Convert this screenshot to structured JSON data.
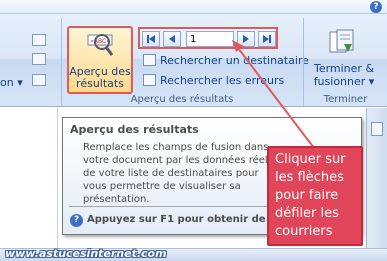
{
  "ribbon": {
    "partial_group_label": "on ▾",
    "apercu_button_line1": "Aperçu des",
    "apercu_button_line2": "résultats",
    "apercu_button_image_text": "«ABC»",
    "record_value": "1",
    "rechercher_destinataire": "Rechercher un destinataire",
    "rechercher_erreurs": "Rechercher les erreurs",
    "group_apercu_label": "Aperçu des résultats",
    "terminer_line1": "Terminer &",
    "terminer_line2": "fusionner ▾",
    "group_terminer_label": "Terminer",
    "help_glyph": "?"
  },
  "tooltip": {
    "title": "Aperçu des résultats",
    "body": "Remplace les champs de fusion dans votre document par les données réelles de votre liste de destinataires pour vous permettre de visualiser sa présentation.",
    "help_text": "Appuyez sur F1 pour obtenir de l'aide."
  },
  "annotation": {
    "text": "Cliquer sur\nles flèches\npour faire\ndéfiler les\ncourriers"
  },
  "watermark": "www.astucesinternet.com",
  "colors": {
    "highlight_red": "#e05a5a",
    "callout_fill": "#e0455a",
    "ribbon_text": "#15428b"
  }
}
